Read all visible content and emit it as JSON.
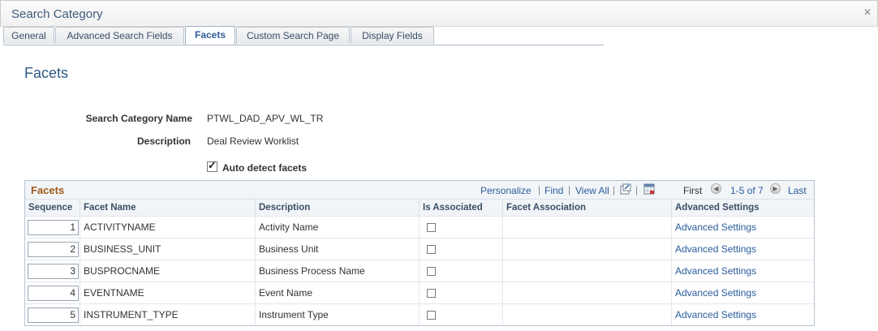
{
  "window": {
    "title": "Search Category"
  },
  "tabs": [
    {
      "label": "General"
    },
    {
      "label": "Advanced Search Fields"
    },
    {
      "label": "Facets"
    },
    {
      "label": "Custom Search Page"
    },
    {
      "label": "Display Fields"
    }
  ],
  "page": {
    "title": "Facets",
    "search_category_name_label": "Search Category Name",
    "search_category_name_value": "PTWL_DAD_APV_WL_TR",
    "description_label": "Description",
    "description_value": "Deal Review Worklist",
    "auto_detect_label": "Auto detect facets",
    "auto_detect_checked": true
  },
  "grid": {
    "title": "Facets",
    "personalize": "Personalize",
    "find": "Find",
    "view_all": "View All",
    "first": "First",
    "range": "1-5 of 7",
    "last": "Last",
    "columns": [
      "Sequence",
      "Facet Name",
      "Description",
      "Is Associated",
      "Facet Association",
      "Advanced Settings"
    ],
    "rows": [
      {
        "sequence": "1",
        "facet_name": "ACTIVITYNAME",
        "description": "Activity Name",
        "is_associated": false,
        "facet_association": "",
        "advanced": "Advanced Settings"
      },
      {
        "sequence": "2",
        "facet_name": "BUSINESS_UNIT",
        "description": "Business Unit",
        "is_associated": false,
        "facet_association": "",
        "advanced": "Advanced Settings"
      },
      {
        "sequence": "3",
        "facet_name": "BUSPROCNAME",
        "description": "Business Process Name",
        "is_associated": false,
        "facet_association": "",
        "advanced": "Advanced Settings"
      },
      {
        "sequence": "4",
        "facet_name": "EVENTNAME",
        "description": "Event Name",
        "is_associated": false,
        "facet_association": "",
        "advanced": "Advanced Settings"
      },
      {
        "sequence": "5",
        "facet_name": "INSTRUMENT_TYPE",
        "description": "Instrument Type",
        "is_associated": false,
        "facet_association": "",
        "advanced": "Advanced Settings"
      }
    ]
  },
  "colors": {
    "accent": "#2a5c9a",
    "title": "#2f5b85",
    "grid_title": "#9c5b1c"
  }
}
